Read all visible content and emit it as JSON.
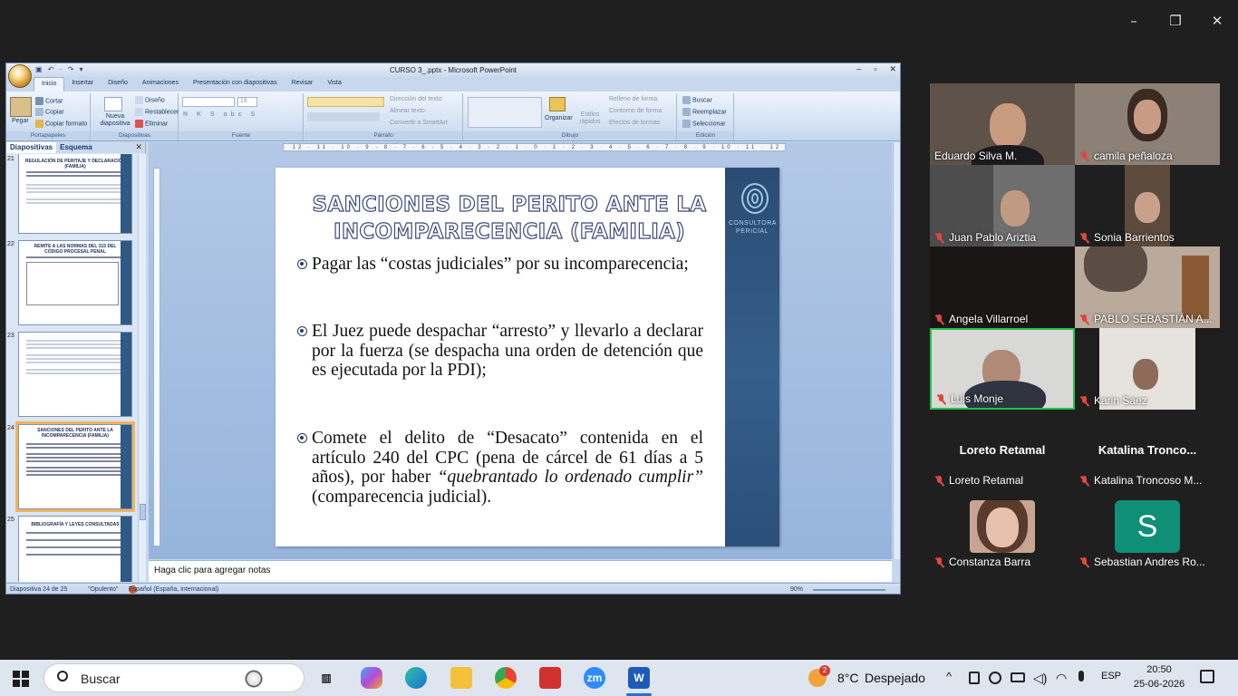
{
  "zoom_window": {
    "controls": {
      "minimize": "–",
      "restore": "❐",
      "close": "✕"
    }
  },
  "powerpoint": {
    "title": "CURSO 3_.pptx - Microsoft PowerPoint",
    "quick_access": "▣ ↶ · ↷ ▾",
    "window_controls": {
      "minimize": "–",
      "restore": "▫",
      "close": "✕"
    },
    "tabs": [
      "Inicio",
      "Insertar",
      "Diseño",
      "Animaciones",
      "Presentación con diapositivas",
      "Revisar",
      "Vista"
    ],
    "ribbon": {
      "portapapeles": {
        "label": "Portapapeles",
        "paste": "Pegar",
        "cut": "Cortar",
        "copy": "Copiar",
        "format_painter": "Copiar formato"
      },
      "diapositivas": {
        "label": "Diapositivas",
        "new_slide": "Nueva diapositiva",
        "layout": "Diseño",
        "reset": "Restablecer",
        "delete": "Eliminar"
      },
      "fuente": {
        "label": "Fuente",
        "size": "18"
      },
      "parrafo": {
        "label": "Párrafo",
        "text_direction": "Dirección del texto",
        "align_text": "Alinear texto",
        "smartart": "Convertir a SmartArt"
      },
      "dibujo": {
        "label": "Dibujo",
        "arrange": "Organizar",
        "quick_styles": "Estilos rápidos",
        "fill": "Relleno de forma",
        "outline": "Contorno de forma",
        "effects": "Efectos de formas"
      },
      "edicion": {
        "label": "Edición",
        "find": "Buscar",
        "replace": "Reemplazar",
        "select": "Seleccionar"
      }
    },
    "pane": {
      "tab_slides": "Diapositivas",
      "tab_outline": "Esquema",
      "close": "✕"
    },
    "thumbnails": [
      {
        "num": "21",
        "title": "REGULACIÓN DE PERITAJE Y DECLARACIÓN (FAMILIA)"
      },
      {
        "num": "22",
        "title": "REMITE A LAS NORMAS DEL 315 DEL CÓDIGO PROCESAL PENAL"
      },
      {
        "num": "23",
        "title": ""
      },
      {
        "num": "24",
        "title": "SANCIONES DEL PERITO ANTE LA INCOMPARECENCIA (FAMILIA)"
      },
      {
        "num": "25",
        "title": "BIBLIOGRAFÍA Y LEYES CONSULTADAS"
      }
    ],
    "ruler_text": "· 12 · 11 · 10 · 9 · 8 · 7 · 6 · 5 · 4 · 3 · 2 · 1 · 0 · 1 · 2 · 3 · 4 · 5 · 6 · 7 · 8 · 9 · 10 · 11 · 12 ·",
    "slide": {
      "title": "SANCIONES DEL PERITO ANTE LA INCOMPARECENCIA (FAMILIA)",
      "logo_text": "CONSULTORA PERICIAL",
      "bullet1": "Pagar las “costas judiciales” por su incomparecencia;",
      "bullet2": "El Juez puede despachar “arresto” y llevarlo a declarar por la fuerza (se despacha una orden de detención que es ejecutada por la PDI);",
      "bullet3_a": "Comete el delito de “Desacato” contenida en el artículo 240 del CPC (pena de cárcel de 61 días a 5 años), por haber ",
      "bullet3_b": "“quebrantado lo ordenado cumplir”",
      "bullet3_c": " (comparecencia judicial).",
      "number": "24"
    },
    "notes_placeholder": "Haga clic para agregar notas",
    "status": {
      "slide": "Diapositiva 24 de 25",
      "theme": "\"Opulento\"",
      "language": "Español (España, internacional)",
      "zoom": "90%"
    }
  },
  "participants": [
    {
      "name": "Eduardo Silva M.",
      "muted": false
    },
    {
      "name": "camila peñaloza",
      "muted": true
    },
    {
      "name": "Juan Pablo Ariztia",
      "muted": true
    },
    {
      "name": "Sonia Barrientos",
      "muted": true
    },
    {
      "name": "Angela Villarroel",
      "muted": true
    },
    {
      "name": "PABLO SEBASTIÁN A...",
      "muted": true
    },
    {
      "name": "Luis Monje",
      "muted": true,
      "active_speaker": true
    },
    {
      "name": "Karin Saez",
      "muted": true
    }
  ],
  "no_video": [
    {
      "display": "Loreto Retamal",
      "label": "Loreto Retamal"
    },
    {
      "display": "Katalina  Tronco...",
      "label": "Katalina Troncoso M..."
    }
  ],
  "photo_tiles": [
    {
      "name": "Constanza Barra"
    },
    {
      "name": "Sebastian Andres Ro...",
      "avatar_letter": "S",
      "avatar_color": "#0f8f76"
    }
  ],
  "taskbar": {
    "search": "Buscar",
    "weather_temp": "8°C",
    "weather_text": "Despejado",
    "weather_badge": "2",
    "language": "ESP",
    "time": "20:50",
    "date": "25-06-2026",
    "tray_arrow": "^",
    "app_letters": {
      "zoom": "zm",
      "word": "W"
    }
  }
}
